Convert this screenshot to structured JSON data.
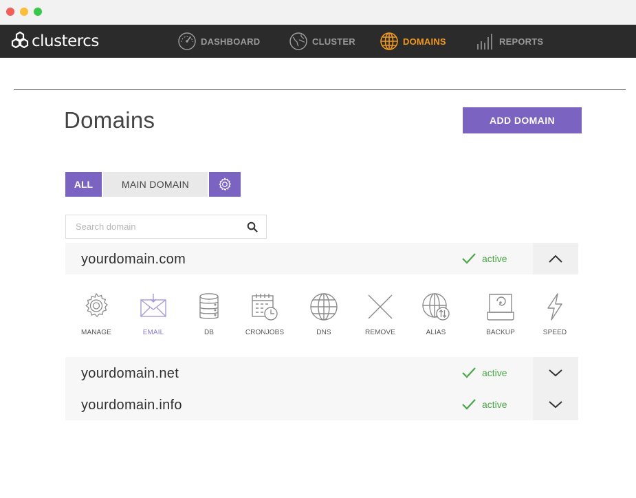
{
  "app": {
    "logo_text": "clustercs"
  },
  "nav": {
    "dashboard": "DASHBOARD",
    "cluster": "CLUSTER",
    "domains": "DOMAINS",
    "reports": "REPORTS"
  },
  "page": {
    "title": "Domains",
    "add_button": "ADD DOMAIN"
  },
  "filters": {
    "all": "ALL",
    "main_domain": "MAIN DOMAIN"
  },
  "search": {
    "placeholder": "Search domain"
  },
  "domains": [
    {
      "name": "yourdomain.com",
      "status": "active",
      "expanded": true
    },
    {
      "name": "yourdomain.net",
      "status": "active",
      "expanded": false
    },
    {
      "name": "yourdomain.info",
      "status": "active",
      "expanded": false
    }
  ],
  "actions": {
    "manage": "MANAGE",
    "email": "EMAIL",
    "db": "DB",
    "cronjobs": "CRONJOBS",
    "dns": "DNS",
    "remove": "REMOVE",
    "alias": "ALIAS",
    "backup": "BACKUP",
    "speed": "SPEED"
  },
  "colors": {
    "accent": "#7b63c1",
    "nav_active": "#f39a1e",
    "status_active": "#4aa647",
    "navbar_bg": "#2b2b2b"
  },
  "icons": {
    "logo": "hexagon-cluster-icon",
    "dashboard": "gauge-icon",
    "cluster": "globe-earth-icon",
    "domains": "globe-icon",
    "reports": "bar-chart-icon",
    "settings": "gear-icon",
    "search": "search-icon",
    "status": "check-icon",
    "collapse": "chevron-up-icon",
    "expand": "chevron-down-icon"
  }
}
